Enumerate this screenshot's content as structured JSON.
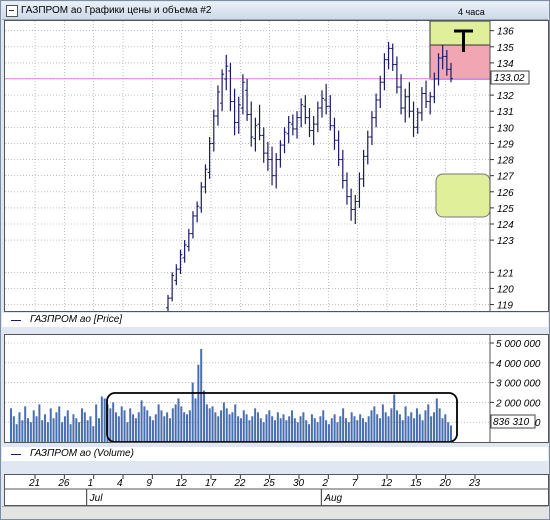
{
  "window": {
    "title": "ГАЗПРОМ ао Графики цены и объема #2",
    "timeframe": "4 часа"
  },
  "price_panel": {
    "legend": "ГАЗПРОМ ао [Price]",
    "current_value": "133.02",
    "y_ticks": [
      "136",
      "135",
      "134",
      "133",
      "132",
      "131",
      "130",
      "129",
      "128",
      "127",
      "126",
      "125",
      "124",
      "123",
      "121",
      "120",
      "119"
    ],
    "colors": {
      "bars": "#1a1a66",
      "current_line": "#dd88dd",
      "box_green": "#e0ef9a",
      "box_red": "#f2a6b4",
      "grid": "#999999"
    }
  },
  "volume_panel": {
    "legend": "ГАЗПРОМ ао (Volume)",
    "current_value": "836 310",
    "y_ticks": [
      "5 000 000",
      "4 000 000",
      "3 000 000",
      "2 000 000",
      "1 000 000"
    ],
    "colors": {
      "bars": "#4a6fb0"
    }
  },
  "time_axis": {
    "day_labels": [
      "21",
      "26",
      "1",
      "4",
      "9",
      "12",
      "17",
      "22",
      "25",
      "30",
      "2",
      "7",
      "12",
      "15",
      "20",
      "23"
    ],
    "month_labels": [
      "Jul",
      "Aug"
    ]
  },
  "chart_data": [
    {
      "type": "ohlc",
      "title": "",
      "series_name": "ГАЗПРОМ ао [Price]",
      "ylim": [
        118.6,
        136.6
      ],
      "grid": true,
      "x_days": [
        "21",
        "26",
        "1",
        "4",
        "9",
        "12",
        "17",
        "22",
        "25",
        "30",
        "2",
        "7",
        "12",
        "15",
        "20",
        "23"
      ],
      "bars": [
        [
          118.8,
          119.6,
          118.6,
          119.4
        ],
        [
          119.4,
          121.0,
          119.2,
          120.8
        ],
        [
          120.5,
          121.5,
          120.2,
          121.2
        ],
        [
          121.2,
          122.4,
          120.9,
          122.1
        ],
        [
          121.9,
          123.0,
          121.6,
          122.7
        ],
        [
          122.6,
          123.7,
          122.3,
          123.4
        ],
        [
          123.4,
          124.8,
          123.1,
          124.5
        ],
        [
          124.5,
          125.4,
          124.1,
          125.1
        ],
        [
          125.0,
          126.6,
          124.7,
          126.3
        ],
        [
          126.3,
          127.7,
          125.9,
          127.4
        ],
        [
          127.2,
          129.4,
          126.8,
          129.0
        ],
        [
          129.0,
          131.1,
          128.5,
          130.7
        ],
        [
          130.7,
          132.6,
          130.1,
          132.2
        ],
        [
          131.5,
          133.6,
          131.0,
          133.3
        ],
        [
          133.0,
          134.5,
          132.3,
          133.8
        ],
        [
          133.5,
          134.0,
          131.0,
          131.6
        ],
        [
          131.6,
          132.4,
          129.5,
          130.3
        ],
        [
          130.3,
          131.9,
          129.6,
          131.4
        ],
        [
          131.2,
          133.3,
          130.8,
          132.8
        ],
        [
          132.3,
          133.0,
          130.4,
          130.8
        ],
        [
          130.8,
          131.6,
          128.8,
          129.4
        ],
        [
          129.3,
          130.6,
          128.5,
          130.1
        ],
        [
          130.2,
          131.4,
          129.2,
          129.5
        ],
        [
          129.5,
          130.0,
          127.8,
          128.4
        ],
        [
          128.4,
          129.1,
          127.3,
          128.0
        ],
        [
          128.0,
          128.8,
          126.4,
          127.0
        ],
        [
          127.0,
          128.4,
          126.2,
          128.0
        ],
        [
          128.0,
          129.2,
          127.5,
          128.9
        ],
        [
          128.9,
          130.0,
          128.4,
          129.7
        ],
        [
          129.6,
          130.7,
          129.0,
          130.3
        ],
        [
          130.2,
          130.8,
          129.5,
          129.9
        ],
        [
          129.9,
          131.0,
          129.3,
          130.6
        ],
        [
          130.6,
          131.8,
          130.0,
          131.4
        ],
        [
          131.3,
          132.0,
          130.2,
          130.6
        ],
        [
          130.6,
          131.2,
          129.4,
          129.8
        ],
        [
          129.8,
          130.7,
          128.9,
          130.2
        ],
        [
          130.2,
          131.6,
          129.7,
          131.2
        ],
        [
          131.2,
          132.3,
          130.6,
          131.8
        ],
        [
          131.7,
          132.7,
          130.8,
          131.3
        ],
        [
          131.3,
          132.0,
          129.8,
          130.1
        ],
        [
          130.1,
          130.6,
          128.6,
          129.2
        ],
        [
          129.2,
          129.8,
          127.6,
          128.0
        ],
        [
          128.0,
          128.6,
          126.2,
          126.7
        ],
        [
          126.7,
          127.2,
          125.2,
          125.7
        ],
        [
          125.7,
          126.2,
          124.2,
          124.9
        ],
        [
          124.9,
          125.8,
          124.0,
          125.4
        ],
        [
          125.4,
          127.2,
          125.0,
          126.8
        ],
        [
          126.8,
          128.6,
          126.3,
          128.2
        ],
        [
          128.2,
          129.8,
          127.7,
          129.4
        ],
        [
          129.4,
          131.0,
          128.9,
          130.6
        ],
        [
          130.6,
          132.1,
          130.0,
          131.7
        ],
        [
          131.7,
          133.2,
          131.2,
          132.8
        ],
        [
          132.8,
          134.6,
          132.3,
          134.2
        ],
        [
          134.2,
          135.3,
          133.6,
          134.9
        ],
        [
          134.9,
          135.2,
          133.5,
          133.9
        ],
        [
          133.9,
          134.4,
          132.1,
          132.5
        ],
        [
          132.5,
          133.3,
          130.8,
          131.2
        ],
        [
          131.2,
          132.4,
          130.3,
          131.9
        ],
        [
          131.9,
          132.8,
          130.6,
          131.0
        ],
        [
          131.0,
          131.6,
          129.4,
          130.0
        ],
        [
          130.0,
          131.2,
          129.6,
          130.9
        ],
        [
          130.9,
          132.5,
          130.4,
          132.1
        ],
        [
          132.1,
          132.9,
          131.2,
          131.6
        ],
        [
          131.6,
          132.2,
          130.8,
          131.9
        ],
        [
          131.9,
          133.4,
          131.5,
          133.0
        ],
        [
          133.0,
          134.6,
          132.6,
          134.3
        ],
        [
          134.3,
          135.1,
          133.6,
          134.4
        ],
        [
          134.4,
          134.8,
          133.2,
          133.6
        ],
        [
          133.6,
          134.0,
          132.8,
          133.02
        ]
      ]
    },
    {
      "type": "bar",
      "title": "",
      "series_name": "ГАЗПРОМ ао (Volume)",
      "ylim": [
        0,
        5000000
      ],
      "values": [
        1700000,
        1300000,
        900000,
        1500000,
        1100000,
        1800000,
        1200000,
        1000000,
        1600000,
        1300000,
        1900000,
        1100000,
        1400000,
        1000000,
        1700000,
        1200000,
        1500000,
        1800000,
        1000000,
        1300000,
        1600000,
        900000,
        1400000,
        1200000,
        1000000,
        1700000,
        1500000,
        1100000,
        1300000,
        800000,
        1900000,
        1200000,
        2300000,
        2200000,
        1900000,
        1700000,
        2000000,
        1500000,
        1300000,
        1800000,
        1600000,
        1000000,
        1700000,
        1400000,
        1200000,
        1500000,
        2100000,
        1800000,
        1600000,
        1300000,
        1100000,
        1400000,
        1900000,
        1600000,
        1300000,
        1500000,
        1200000,
        1700000,
        1900000,
        2200000,
        1800000,
        1500000,
        1400000,
        1600000,
        3000000,
        2200000,
        3900000,
        4700000,
        2600000,
        1900000,
        1700000,
        1800000,
        1500000,
        1300000,
        1600000,
        2000000,
        1700000,
        1400000,
        1500000,
        1900000,
        1300000,
        1200000,
        1600000,
        1400000,
        1100000,
        1300000,
        1700000,
        1500000,
        1200000,
        1000000,
        1400000,
        1600000,
        1300000,
        1100000,
        1500000,
        1200000,
        1400000,
        1100000,
        1300000,
        1600000,
        1200000,
        1000000,
        1300000,
        1500000,
        1100000,
        900000,
        1400000,
        1200000,
        1000000,
        1300000,
        1600000,
        1100000,
        900000,
        1200000,
        1400000,
        1000000,
        1300000,
        1700000,
        1200000,
        1000000,
        1500000,
        1300000,
        1100000,
        1400000,
        1200000,
        1000000,
        1300000,
        1600000,
        1800000,
        1400000,
        1200000,
        1900000,
        1500000,
        1300000,
        1700000,
        2400000,
        1600000,
        1400000,
        1100000,
        1800000,
        1300000,
        1500000,
        1200000,
        1700000,
        1400000,
        1100000,
        1600000,
        1900000,
        1300000,
        1500000,
        2200000,
        1700000,
        1200000,
        1400000,
        1000000,
        836310
      ]
    }
  ]
}
